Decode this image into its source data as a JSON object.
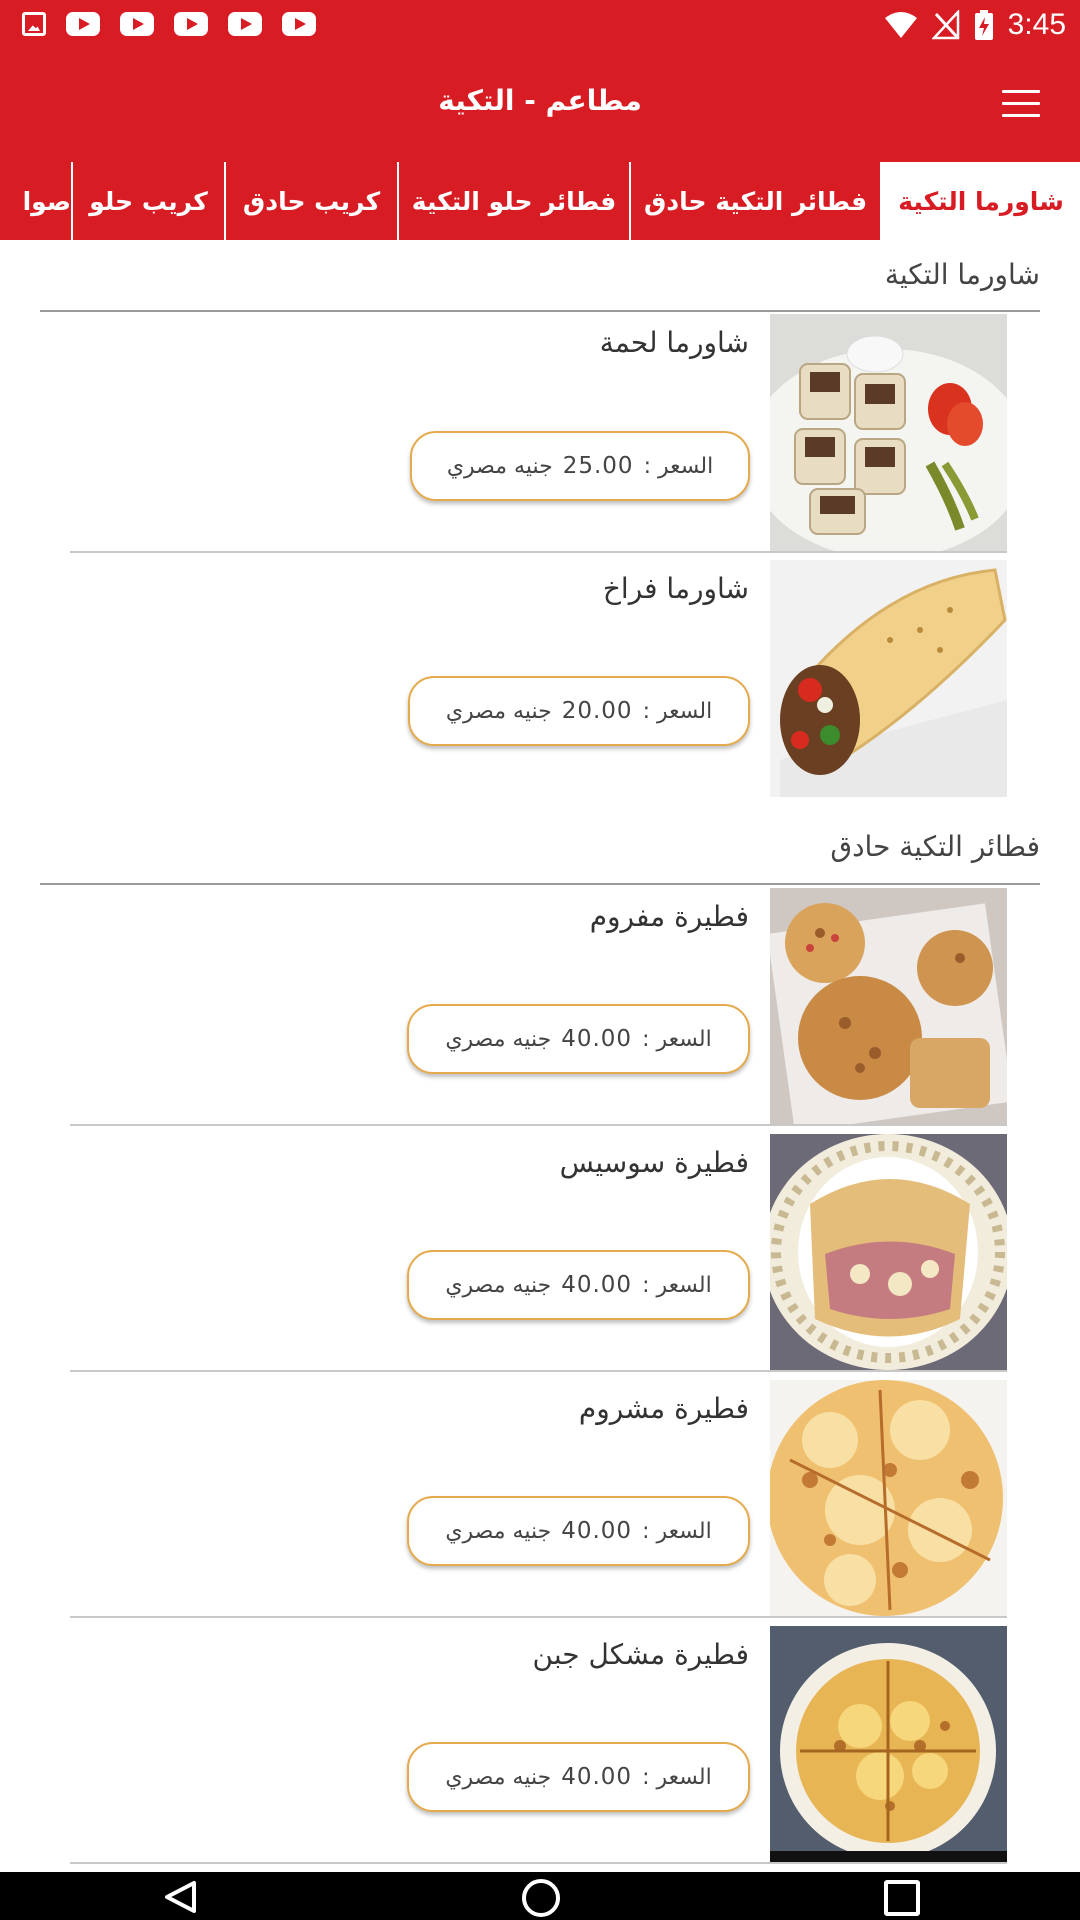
{
  "status_bar": {
    "time": "3:45"
  },
  "app_bar": {
    "title": "مطاعم - التكية"
  },
  "tabs": [
    {
      "label": "شاورما التكية"
    },
    {
      "label": "فطائر التكية حادق"
    },
    {
      "label": "فطائر حلو التكية"
    },
    {
      "label": "كريب حادق"
    },
    {
      "label": "كريب حلو"
    },
    {
      "label": "صوا"
    }
  ],
  "sections": [
    {
      "title": "شاورما التكية",
      "items": [
        {
          "name": "شاورما لحمة",
          "price_label": "السعر :",
          "price": "25.00",
          "currency": "جنيه مصري"
        },
        {
          "name": "شاورما فراخ",
          "price_label": "السعر :",
          "price": "20.00",
          "currency": "جنيه مصري"
        }
      ]
    },
    {
      "title": "فطائر التكية حادق",
      "items": [
        {
          "name": "فطيرة مفروم",
          "price_label": "السعر :",
          "price": "40.00",
          "currency": "جنيه مصري"
        },
        {
          "name": "فطيرة سوسيس",
          "price_label": "السعر :",
          "price": "40.00",
          "currency": "جنيه مصري"
        },
        {
          "name": "فطيرة مشروم",
          "price_label": "السعر :",
          "price": "40.00",
          "currency": "جنيه مصري"
        },
        {
          "name": "فطيرة مشكل جبن",
          "price_label": "السعر :",
          "price": "40.00",
          "currency": "جنيه مصري"
        }
      ]
    }
  ],
  "colors": {
    "primary": "#d81c23",
    "pill_border": "#e5aa4c"
  },
  "icons": {
    "menu": "hamburger-icon",
    "wifi": "wifi-icon",
    "signal": "no-signal-icon",
    "battery": "battery-charging-icon"
  }
}
